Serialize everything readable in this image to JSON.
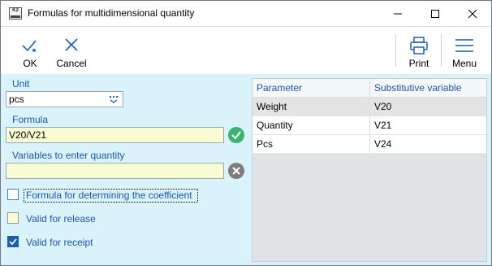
{
  "window": {
    "title": "Formulas for multidimensional quantity",
    "icon": "K2-app-icon"
  },
  "toolbar": {
    "ok_label": "OK",
    "cancel_label": "Cancel",
    "print_label": "Print",
    "menu_label": "Menu"
  },
  "form": {
    "unit_label": "Unit",
    "unit_value": "pcs",
    "formula_label": "Formula",
    "formula_value": "V20/V21",
    "formula_status": "valid",
    "variables_label": "Variables to enter quantity",
    "variables_value": "",
    "variables_status": "empty",
    "checkboxes": [
      {
        "label": "Formula for determining the coefficient",
        "checked": false
      },
      {
        "label": "Valid for release",
        "checked": false
      },
      {
        "label": "Valid for receipt",
        "checked": true
      }
    ]
  },
  "table": {
    "columns": [
      "Parameter",
      "Substitutive variable"
    ],
    "rows": [
      [
        "Weight",
        "V20"
      ],
      [
        "Quantity",
        "V21"
      ],
      [
        "Pcs",
        "V24"
      ]
    ],
    "selected_row": 0
  },
  "colors": {
    "panel_bg": "#daf3fb",
    "field_bg": "#fafdd3",
    "label_blue": "#1a56a4",
    "valid_green": "#3cb371",
    "clear_gray": "#7d7d7d",
    "checkbox_blue": "#1f5ea8"
  }
}
